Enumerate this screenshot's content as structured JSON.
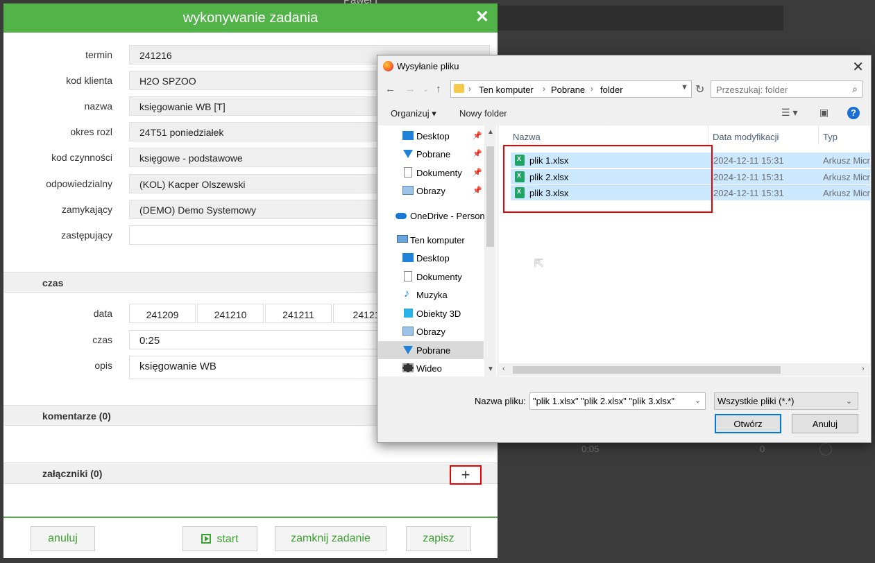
{
  "background": {
    "title": "Paweł I",
    "row_time": "0:05",
    "row_count": "0"
  },
  "task": {
    "title": "wykonywanie zadania",
    "close_symbol": "✕",
    "fields": [
      {
        "label": "termin",
        "value": "241216"
      },
      {
        "label": "kod klienta",
        "value": "H2O SPZOO"
      },
      {
        "label": "nazwa",
        "value": "księgowanie WB [T]"
      },
      {
        "label": "okres rozl",
        "value": "24T51 poniedziałek"
      },
      {
        "label": "kod czynności",
        "value": "księgowe - podstawowe"
      },
      {
        "label": "odpowiedzialny",
        "value": "(KOL) Kacper Olszewski"
      },
      {
        "label": "zamykający",
        "value": "(DEMO) Demo Systemowy"
      },
      {
        "label": "zastępujący",
        "value": ""
      }
    ],
    "czas_section": "czas",
    "data_label": "data",
    "dates": [
      "241209",
      "241210",
      "241211",
      "24121"
    ],
    "czas_label": "czas",
    "czas_value": "0:25",
    "opis_label": "opis",
    "opis_value": "księgowanie WB",
    "komentarze_label": "komentarze (0)",
    "zalaczniki_label": "załączniki (0)",
    "add_symbol": "+",
    "buttons": {
      "cancel": "anuluj",
      "start": "start",
      "close_task": "zamknij zadanie",
      "save": "zapisz"
    }
  },
  "dialog": {
    "title": "Wysyłanie pliku",
    "close_symbol": "✕",
    "nav": {
      "back": "←",
      "forward": "→",
      "recent": "⌄",
      "up": "↑",
      "refresh": "↻"
    },
    "breadcrumbs": [
      "Ten komputer",
      "Pobrane",
      "folder"
    ],
    "search_placeholder": "Przeszukaj: folder",
    "toolbar": {
      "organize": "Organizuj ▾",
      "new_folder": "Nowy folder",
      "help": "?"
    },
    "tree": [
      {
        "label": "Desktop",
        "icon": "desktop-icon",
        "pinned": true
      },
      {
        "label": "Pobrane",
        "icon": "download-icon",
        "pinned": true
      },
      {
        "label": "Dokumenty",
        "icon": "documents-icon",
        "pinned": true
      },
      {
        "label": "Obrazy",
        "icon": "pictures-icon",
        "pinned": true
      },
      {
        "label": "OneDrive - Person",
        "icon": "onedrive-icon",
        "pinned": false
      },
      {
        "label": "Ten komputer",
        "icon": "computer-icon",
        "pinned": false
      },
      {
        "label": "Desktop",
        "icon": "desktop-icon",
        "pinned": false
      },
      {
        "label": "Dokumenty",
        "icon": "documents-icon",
        "pinned": false
      },
      {
        "label": "Muzyka",
        "icon": "music-icon",
        "pinned": false
      },
      {
        "label": "Obiekty 3D",
        "icon": "3d-objects-icon",
        "pinned": false
      },
      {
        "label": "Obrazy",
        "icon": "pictures-icon",
        "pinned": false
      },
      {
        "label": "Pobrane",
        "icon": "download-icon",
        "pinned": false,
        "selected": true
      },
      {
        "label": "Wideo",
        "icon": "video-icon",
        "pinned": false
      }
    ],
    "columns": {
      "name": "Nazwa",
      "date": "Data modyfikacji",
      "type": "Typ"
    },
    "files": [
      {
        "name": "plik 1.xlsx",
        "date": "2024-12-11 15:31",
        "type": "Arkusz Microsoft Excel"
      },
      {
        "name": "plik 2.xlsx",
        "date": "2024-12-11 15:31",
        "type": "Arkusz Microsoft Excel"
      },
      {
        "name": "plik 3.xlsx",
        "date": "2024-12-11 15:31",
        "type": "Arkusz Microsoft Excel"
      }
    ],
    "filename_label": "Nazwa pliku:",
    "filename_value": "\"plik 1.xlsx\" \"plik 2.xlsx\" \"plik 3.xlsx\"",
    "filetype_value": "Wszystkie pliki (*.*)",
    "open_label": "Otwórz",
    "cancel_label": "Anuluj"
  }
}
